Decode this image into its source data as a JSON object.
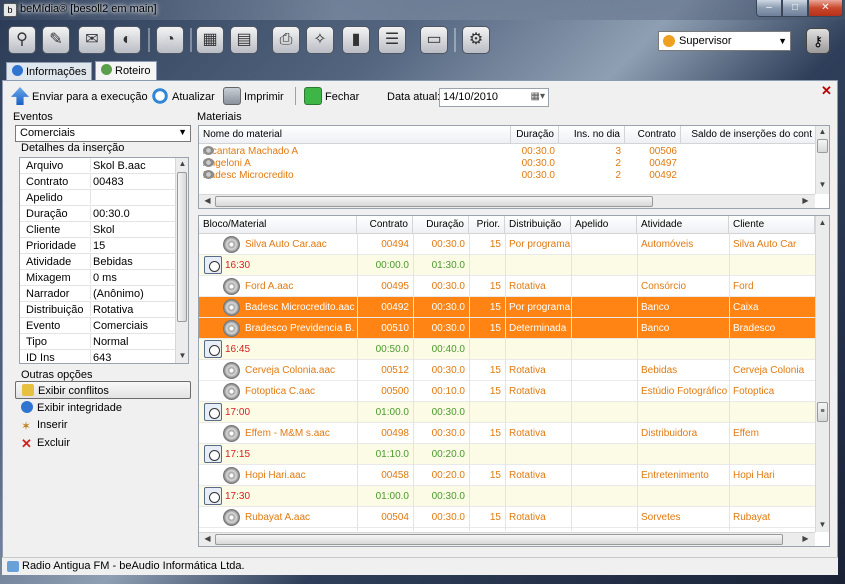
{
  "window": {
    "title": "beMídia® [besoll2 em main]"
  },
  "toolbar": {
    "icons": [
      "user-search-icon",
      "edit-icon",
      "notes-icon",
      "media-icon",
      "pie-chart-icon",
      "calculator-icon",
      "report-icon",
      "printer-icon",
      "cleaning-icon",
      "bottle-icon",
      "list-icon",
      "briefcase-icon",
      "settings-icon"
    ],
    "user": "Supervisor"
  },
  "tabs": [
    {
      "label": "Informações"
    },
    {
      "label": "Roteiro"
    }
  ],
  "actions": {
    "enviar": "Enviar para a execução",
    "atualizar": "Atualizar",
    "imprimir": "Imprimir",
    "fechar": "Fechar",
    "data_label": "Data atual:",
    "data_value": "14/10/2010"
  },
  "left": {
    "eventos_label": "Eventos",
    "eventos_value": "Comerciais",
    "detalhes_label": "Detalhes da inserção",
    "props": [
      {
        "k": "Arquivo",
        "v": "Skol B.aac"
      },
      {
        "k": "Contrato",
        "v": "00483"
      },
      {
        "k": "Apelido",
        "v": ""
      },
      {
        "k": "Duração",
        "v": "00:30.0"
      },
      {
        "k": "Cliente",
        "v": "Skol"
      },
      {
        "k": "Prioridade",
        "v": "15"
      },
      {
        "k": "Atividade",
        "v": "Bebidas"
      },
      {
        "k": "Mixagem",
        "v": "0 ms"
      },
      {
        "k": "Narrador",
        "v": "(Anônimo)"
      },
      {
        "k": "Distribuição",
        "v": "Rotativa"
      },
      {
        "k": "Evento",
        "v": "Comerciais"
      },
      {
        "k": "Tipo",
        "v": "Normal"
      },
      {
        "k": "ID Ins",
        "v": "643"
      }
    ],
    "outras_label": "Outras opções",
    "outras": [
      "Exibir conflitos",
      "Exibir integridade",
      "Inserir",
      "Excluir"
    ]
  },
  "materiais": {
    "label": "Materiais",
    "headers": [
      "Nome do material",
      "Duração",
      "Ins. no dia",
      "Contrato",
      "Saldo de inserções do cont"
    ],
    "rows": [
      {
        "nome": "Alcantara Machado A",
        "duracao": "00:30.0",
        "ins": "3",
        "contrato": "00506"
      },
      {
        "nome": "Angeloni A",
        "duracao": "00:30.0",
        "ins": "2",
        "contrato": "00497"
      },
      {
        "nome": "Badesc Microcredito",
        "duracao": "00:30.0",
        "ins": "2",
        "contrato": "00492"
      }
    ]
  },
  "bloco": {
    "headers": [
      "Bloco/Material",
      "Contrato",
      "Duração",
      "Prior.",
      "Distribuição",
      "Apelido",
      "Atividade",
      "Cliente"
    ],
    "rows": [
      {
        "type": "item",
        "name": "Silva Auto Car.aac",
        "contrato": "00494",
        "duracao": "00:30.0",
        "prior": "15",
        "dist": "Por programa",
        "atividade": "Automóveis",
        "cliente": "Silva Auto Car"
      },
      {
        "type": "bloco",
        "name": "16:30",
        "contrato": "00:00.0",
        "duracao": "01:30.0"
      },
      {
        "type": "item",
        "name": "Ford A.aac",
        "contrato": "00495",
        "duracao": "00:30.0",
        "prior": "15",
        "dist": "Rotativa",
        "atividade": "Consórcio",
        "cliente": "Ford"
      },
      {
        "type": "sel",
        "name": "Badesc Microcredito.aac",
        "contrato": "00492",
        "duracao": "00:30.0",
        "prior": "15",
        "dist": "Por programa",
        "atividade": "Banco",
        "cliente": "Caixa"
      },
      {
        "type": "sel",
        "name": "Bradesco Previdencia B....",
        "contrato": "00510",
        "duracao": "00:30.0",
        "prior": "15",
        "dist": "Determinada",
        "atividade": "Banco",
        "cliente": "Bradesco"
      },
      {
        "type": "bloco",
        "name": "16:45",
        "contrato": "00:50.0",
        "duracao": "00:40.0"
      },
      {
        "type": "item",
        "name": "Cerveja Colonia.aac",
        "contrato": "00512",
        "duracao": "00:30.0",
        "prior": "15",
        "dist": "Rotativa",
        "atividade": "Bebidas",
        "cliente": "Cerveja Colonia"
      },
      {
        "type": "item",
        "name": "Fotoptica C.aac",
        "contrato": "00500",
        "duracao": "00:10.0",
        "prior": "15",
        "dist": "Rotativa",
        "atividade": "Estúdio Fotográfico",
        "cliente": "Fotoptica"
      },
      {
        "type": "bloco",
        "name": "17:00",
        "contrato": "01:00.0",
        "duracao": "00:30.0"
      },
      {
        "type": "item",
        "name": "Effem - M&M s.aac",
        "contrato": "00498",
        "duracao": "00:30.0",
        "prior": "15",
        "dist": "Rotativa",
        "atividade": "Distribuidora",
        "cliente": "Effem"
      },
      {
        "type": "bloco",
        "name": "17:15",
        "contrato": "01:10.0",
        "duracao": "00:20.0"
      },
      {
        "type": "item",
        "name": "Hopi Hari.aac",
        "contrato": "00458",
        "duracao": "00:20.0",
        "prior": "15",
        "dist": "Rotativa",
        "atividade": "Entretenimento",
        "cliente": "Hopi Hari"
      },
      {
        "type": "bloco",
        "name": "17:30",
        "contrato": "01:00.0",
        "duracao": "00:30.0"
      },
      {
        "type": "item",
        "name": "Rubayat A.aac",
        "contrato": "00504",
        "duracao": "00:30.0",
        "prior": "15",
        "dist": "Rotativa",
        "atividade": "Sorvetes",
        "cliente": "Rubayat"
      }
    ]
  },
  "status": {
    "text": "Radio Antigua FM - beAudio Informática Ltda."
  },
  "colors": {
    "selected": "#ff8414",
    "item_text": "#e07a10",
    "bloco_time": "#d82020",
    "bloco_text": "#4a9a2a"
  }
}
